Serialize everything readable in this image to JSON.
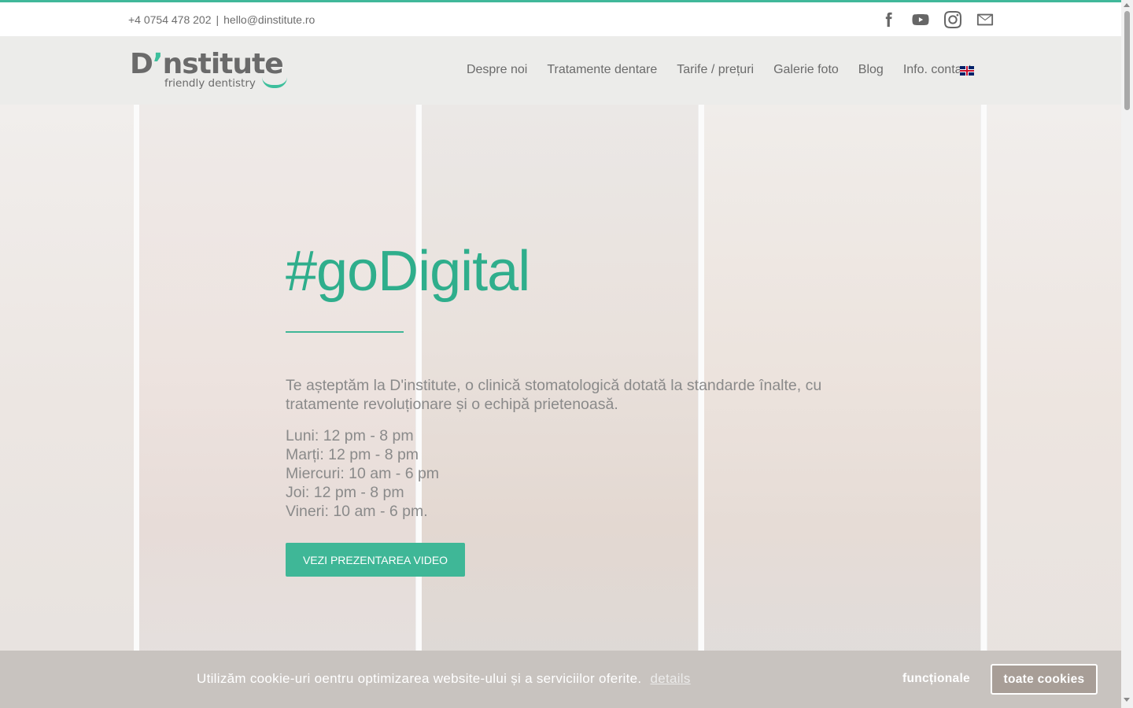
{
  "topbar": {
    "phone": "+4 0754 478 202",
    "separator": "|",
    "email": "hello@dinstitute.ro",
    "socials": [
      "facebook-icon",
      "youtube-icon",
      "instagram-icon",
      "mail-icon"
    ]
  },
  "logo": {
    "brand_start": "D",
    "brand_apos": "’",
    "brand_end": "nstitute",
    "tagline": "friendly dentistry"
  },
  "nav": {
    "items": [
      "Despre noi",
      "Tratamente dentare",
      "Tarife / prețuri",
      "Galerie foto",
      "Blog",
      "Info. contact"
    ],
    "language_icon": "uk-flag-icon"
  },
  "hero": {
    "headline": "#goDigital",
    "intro": "Te așteptăm la D'institute, o clinică stomatologică dotată la standarde înalte, cu tratamente revoluționare și o echipă prietenoasă.",
    "hours": [
      "Luni: 12 pm - 8 pm",
      "Marți: 12 pm - 8 pm",
      "Miercuri: 10 am - 6 pm",
      "Joi: 12 pm - 8 pm",
      "Vineri: 10 am - 6 pm."
    ],
    "cta_label": "VEZI PREZENTAREA VIDEO"
  },
  "cookie": {
    "message": "Utilizăm cookie-uri oentru optimizarea website-ului și a serviciilor oferite.",
    "details_label": "details",
    "functional_label": "funcționale",
    "all_label": "toate cookies"
  },
  "colors": {
    "accent": "#40b89a",
    "header_bg": "#ececea",
    "cookie_bg": "#c8c3bf",
    "text_gray": "#8a8a8a"
  }
}
